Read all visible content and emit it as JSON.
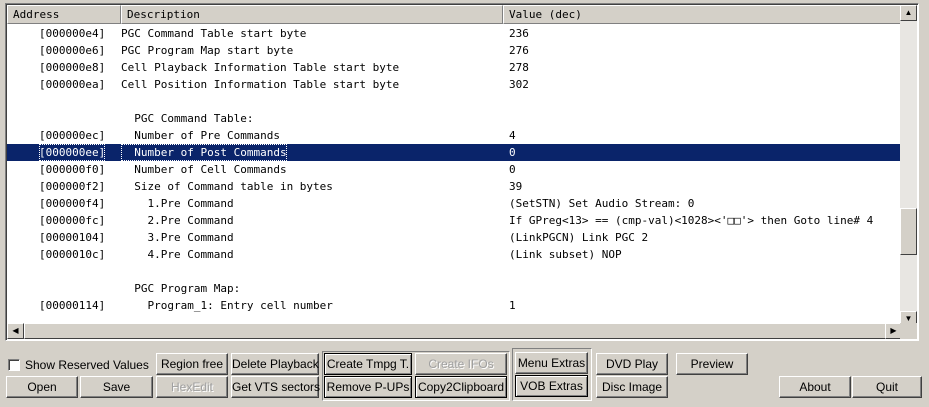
{
  "columns": [
    "Address",
    "Description",
    "Value (dec)"
  ],
  "rows": [
    {
      "addr": "[000000e4]",
      "desc": "PGC Command Table start byte",
      "val": "236"
    },
    {
      "addr": "[000000e6]",
      "desc": "PGC Program Map start byte",
      "val": "276"
    },
    {
      "addr": "[000000e8]",
      "desc": "Cell Playback Information Table start byte",
      "val": "278"
    },
    {
      "addr": "[000000ea]",
      "desc": "Cell Position Information Table start byte",
      "val": "302"
    },
    {
      "addr": "",
      "desc": "",
      "val": ""
    },
    {
      "addr": "",
      "desc": "  PGC Command Table:",
      "val": ""
    },
    {
      "addr": "[000000ec]",
      "desc": "  Number of Pre Commands",
      "val": "4"
    },
    {
      "addr": "[000000ee]",
      "desc": "  Number of Post Commands",
      "val": "0"
    },
    {
      "addr": "[000000f0]",
      "desc": "  Number of Cell Commands",
      "val": "0"
    },
    {
      "addr": "[000000f2]",
      "desc": "  Size of Command table in bytes",
      "val": "39"
    },
    {
      "addr": "[000000f4]",
      "desc": "    1.Pre Command",
      "val": "(SetSTN) Set Audio Stream: 0"
    },
    {
      "addr": "[000000fc]",
      "desc": "    2.Pre Command",
      "val": "If GPreg<13> == (cmp-val)<1028><'□□'> then Goto line# 4"
    },
    {
      "addr": "[00000104]",
      "desc": "    3.Pre Command",
      "val": "(LinkPGCN) Link PGC 2"
    },
    {
      "addr": "[0000010c]",
      "desc": "    4.Pre Command",
      "val": "(Link subset) NOP"
    },
    {
      "addr": "",
      "desc": "",
      "val": ""
    },
    {
      "addr": "",
      "desc": "  PGC Program Map:",
      "val": ""
    },
    {
      "addr": "[00000114]",
      "desc": "    Program_1: Entry cell number",
      "val": "1"
    }
  ],
  "selected_row": 7,
  "checkbox": {
    "label": "Show Reserved Values",
    "checked": false
  },
  "buttons": {
    "open": "Open",
    "save": "Save",
    "region_free": "Region free",
    "hexedit": "HexEdit",
    "delete_playback": "Delete Playback",
    "get_vts_sectors": "Get VTS sectors",
    "create_tmpg": "Create Tmpg T.",
    "remove_pups": "Remove P-UPs",
    "create_ifos": "Create IFOs",
    "copy2clipboard": "Copy2Clipboard",
    "menu_extras": "Menu Extras",
    "vob_extras": "VOB Extras",
    "dvd_play": "DVD Play",
    "disc_image": "Disc Image",
    "preview": "Preview",
    "about": "About",
    "quit": "Quit"
  },
  "icons": {
    "scroll_up": "up-arrow-icon",
    "scroll_down": "down-arrow-icon",
    "scroll_left": "left-arrow-icon",
    "scroll_right": "right-arrow-icon"
  },
  "colors": {
    "selection": "#0a246a",
    "face": "#d4d0c8"
  }
}
